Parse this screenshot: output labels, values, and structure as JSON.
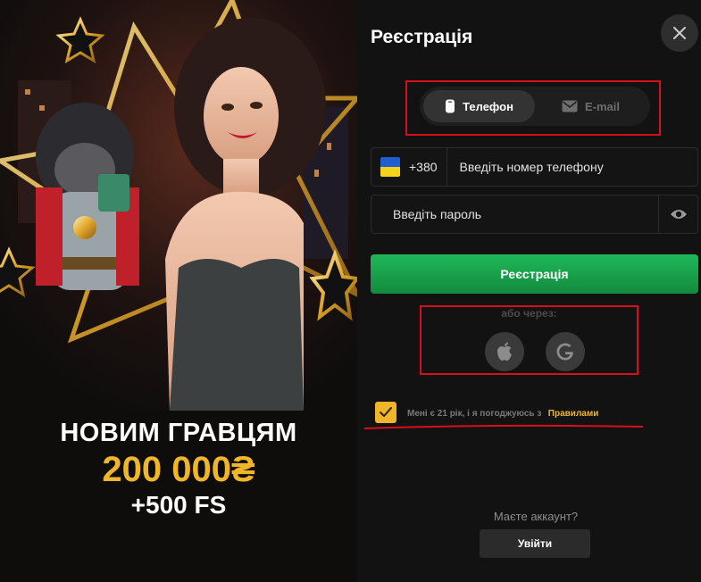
{
  "promo": {
    "headline": "НОВИМ ГРАВЦЯМ",
    "amount": "200 000₴",
    "freespins": "+500 FS"
  },
  "form": {
    "title": "Реєстрація",
    "tabs": [
      {
        "label": "Телефон",
        "active": true,
        "icon": "phone-icon"
      },
      {
        "label": "E-mail",
        "active": false,
        "icon": "mail-icon"
      }
    ],
    "phone": {
      "country_code": "+380",
      "country_flag": "ukraine-flag",
      "placeholder": "Введіть номер телефону"
    },
    "password": {
      "placeholder": "Введіть пароль",
      "toggle_icon": "eye-icon"
    },
    "register_label": "Реєстрація",
    "or_via": "або через:",
    "social": [
      "apple-icon",
      "google-icon"
    ],
    "consent": {
      "checked": true,
      "text": "Мені є 21 рік, і я погоджуюсь з",
      "link": "Правилами"
    },
    "have_account": "Маєте аккаунт?",
    "login_label": "Увійти"
  },
  "colors": {
    "accent_gold": "#f0b62a",
    "primary_green": "#1fb858",
    "highlight_red": "#d6101a"
  }
}
